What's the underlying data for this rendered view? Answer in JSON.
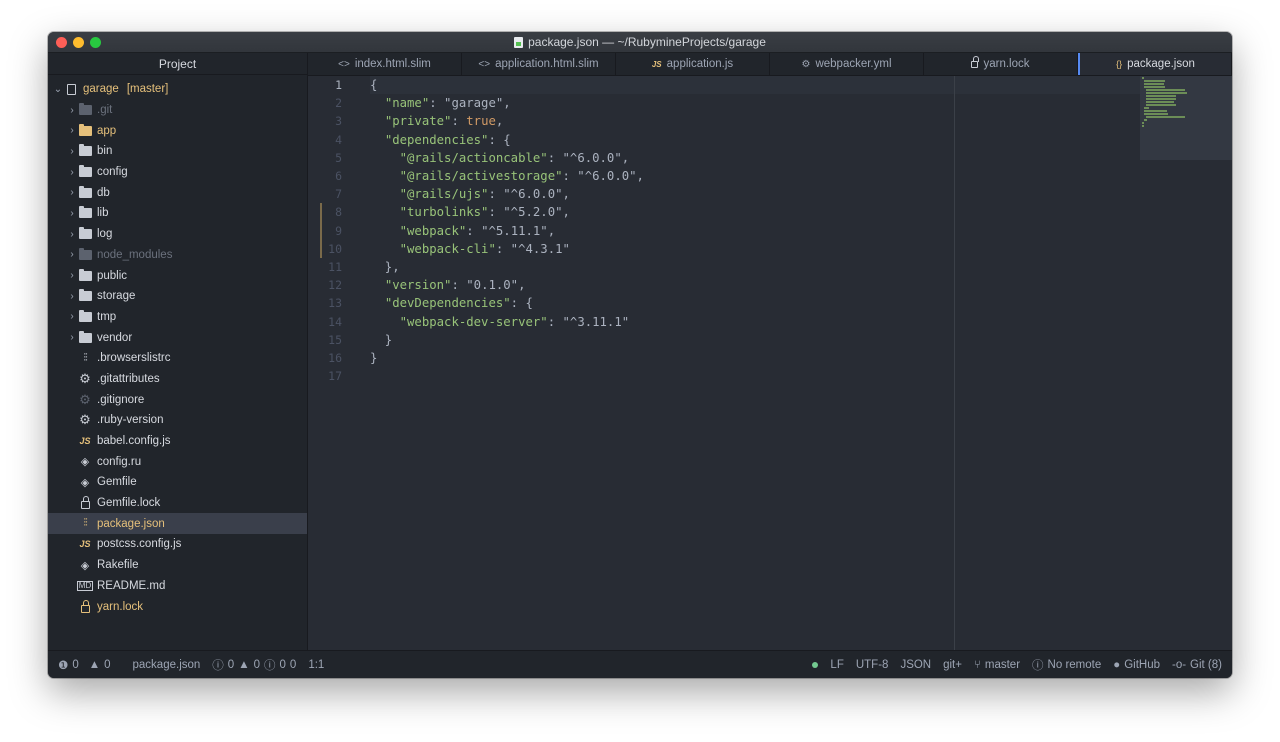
{
  "window": {
    "title": "package.json — ~/RubymineProjects/garage"
  },
  "sidebar": {
    "header": "Project",
    "root": {
      "name": "garage",
      "branch": "[master]"
    },
    "items": [
      {
        "label": ".git",
        "kind": "folder-dim",
        "arrow": true
      },
      {
        "label": "app",
        "kind": "folder-yellow",
        "arrow": true
      },
      {
        "label": "bin",
        "kind": "folder",
        "arrow": true
      },
      {
        "label": "config",
        "kind": "folder",
        "arrow": true
      },
      {
        "label": "db",
        "kind": "folder",
        "arrow": true
      },
      {
        "label": "lib",
        "kind": "folder",
        "arrow": true
      },
      {
        "label": "log",
        "kind": "folder",
        "arrow": true
      },
      {
        "label": "node_modules",
        "kind": "folder-dim",
        "arrow": true
      },
      {
        "label": "public",
        "kind": "folder",
        "arrow": true
      },
      {
        "label": "storage",
        "kind": "folder",
        "arrow": true
      },
      {
        "label": "tmp",
        "kind": "folder",
        "arrow": true
      },
      {
        "label": "vendor",
        "kind": "folder",
        "arrow": true
      },
      {
        "label": ".browserslistrc",
        "kind": "sliders"
      },
      {
        "label": ".gitattributes",
        "kind": "gear"
      },
      {
        "label": ".gitignore",
        "kind": "gear-dim"
      },
      {
        "label": ".ruby-version",
        "kind": "gear"
      },
      {
        "label": "babel.config.js",
        "kind": "js"
      },
      {
        "label": "config.ru",
        "kind": "gem"
      },
      {
        "label": "Gemfile",
        "kind": "gem"
      },
      {
        "label": "Gemfile.lock",
        "kind": "lock"
      },
      {
        "label": "package.json",
        "kind": "sliders-yellow",
        "selected": true
      },
      {
        "label": "postcss.config.js",
        "kind": "js"
      },
      {
        "label": "Rakefile",
        "kind": "gem"
      },
      {
        "label": "README.md",
        "kind": "md"
      },
      {
        "label": "yarn.lock",
        "kind": "lock-yellow"
      }
    ]
  },
  "icons": {
    "js": "JS",
    "gem": "◈",
    "gear": "⚙",
    "sliders": "⫶⫶",
    "md": "MD",
    "chevron": "›",
    "chevron-down": "⌄",
    "code-tab": "<>",
    "curly": "{}"
  },
  "tabs": [
    {
      "label": "index.html.slim",
      "icon": "<>"
    },
    {
      "label": "application.html.slim",
      "icon": "<>"
    },
    {
      "label": "application.js",
      "icon": "JS"
    },
    {
      "label": "webpacker.yml",
      "icon": "⚙"
    },
    {
      "label": "yarn.lock",
      "icon": "lock"
    },
    {
      "label": "package.json",
      "icon": "{}",
      "active": true
    }
  ],
  "editor": {
    "lines": [
      "{",
      "  \"name\": \"garage\",",
      "  \"private\": true,",
      "  \"dependencies\": {",
      "    \"@rails/actioncable\": \"^6.0.0\",",
      "    \"@rails/activestorage\": \"^6.0.0\",",
      "    \"@rails/ujs\": \"^6.0.0\",",
      "    \"turbolinks\": \"^5.2.0\",",
      "    \"webpack\": \"^5.11.1\",",
      "    \"webpack-cli\": \"^4.3.1\"",
      "  },",
      "  \"version\": \"0.1.0\",",
      "  \"devDependencies\": {",
      "    \"webpack-dev-server\": \"^3.11.1\"",
      "  }",
      "}",
      ""
    ],
    "modified_lines": [
      8,
      9,
      10
    ],
    "current_line": 1
  },
  "statusbar": {
    "errors": "0",
    "warnings": "0",
    "file": "package.json",
    "diagnostics": "0",
    "diag_warnings": "0",
    "diag_info": "0",
    "diag_more": "0",
    "cursor": "1:1",
    "line_ending": "LF",
    "encoding": "UTF-8",
    "grammar": "JSON",
    "git_plus": "git+",
    "branch": "master",
    "remote": "No remote",
    "github": "GitHub",
    "git": "Git (8)"
  },
  "colors": {
    "accent": "#568af2",
    "string": "#98c379",
    "boolean": "#d19a66",
    "yellow": "#e5c07b"
  }
}
